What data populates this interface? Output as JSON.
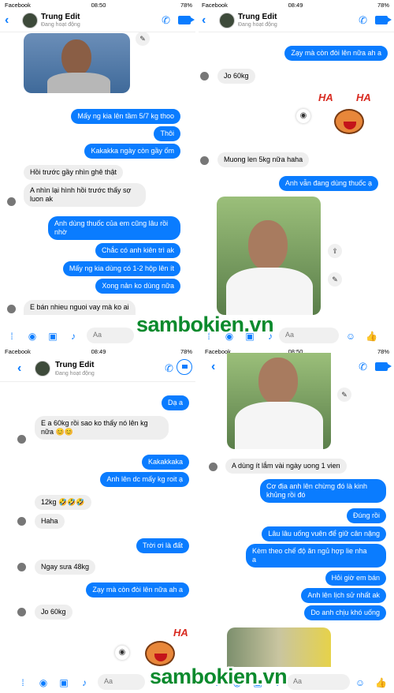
{
  "status": {
    "app": "Facebook",
    "battery": "78%",
    "t1": "08:50",
    "t2": "08:49",
    "t3": "08:49",
    "t4": "08:50"
  },
  "header": {
    "name": "Trung Edit",
    "sub": "Đang hoạt động"
  },
  "p1": {
    "m": [
      "Mấy ng kia lên tầm 5/7 kg thoo",
      "Thôi",
      "Kakakka ngày còn gầy ốm",
      "Hồi trước gầy nhìn ghê thật",
      "A nhìn lại hình hồi trước thấy sợ",
      "luon ak",
      "Anh dùng thuốc của em cũng lâu rồi",
      "nhờ",
      "Chắc có anh kiên trì ak",
      "Mấy ng kia dùng có 1-2 hộp lên ít",
      "Xong nản ko dùng nữa",
      "E bán nhieu nguoi vay mà ko ai"
    ]
  },
  "p2": {
    "m": [
      "Zạy mà còn đòi lên nữa ah a",
      "Jo 60kg",
      "Muong len 5kg nữa haha",
      "Anh vẫn đang dùng thuốc ạ"
    ]
  },
  "p3": {
    "m": [
      "Dạ a",
      "E a 60kg rồi sao ko thấy nó lên kg",
      "nữa 😊😊",
      "Kakakkaka",
      "Anh lên dc mấy kg roit ạ",
      "12kg 🤣🤣🤣",
      "Haha",
      "Trời ơi là đất",
      "Ngay sưa 48kg",
      "Zạy mà còn đòi lên nữa ah a",
      "Jo 60kg"
    ]
  },
  "p4": {
    "m": [
      "A dùng ít lắm vài ngày uong 1 vien",
      "Cơ địa anh lên chừng đó là kinh",
      "khủng rồi đó",
      "Đúng rồi",
      "Lâu lâu uống vuên để giữ cân nặng",
      "Kèm theo chế độ ăn ngủ hợp lie nha",
      "a",
      "Hỏi giờ em bán",
      "Anh lên lịch sử nhất ak",
      "Do anh chịu khó uống"
    ]
  },
  "composer": {
    "placeholder": "Aa"
  },
  "sticker": {
    "ha": "HA"
  },
  "watermark": "sambokien.vn",
  "colors": {
    "accent": "#0a7cff",
    "watermark": "#0b8a2d"
  }
}
